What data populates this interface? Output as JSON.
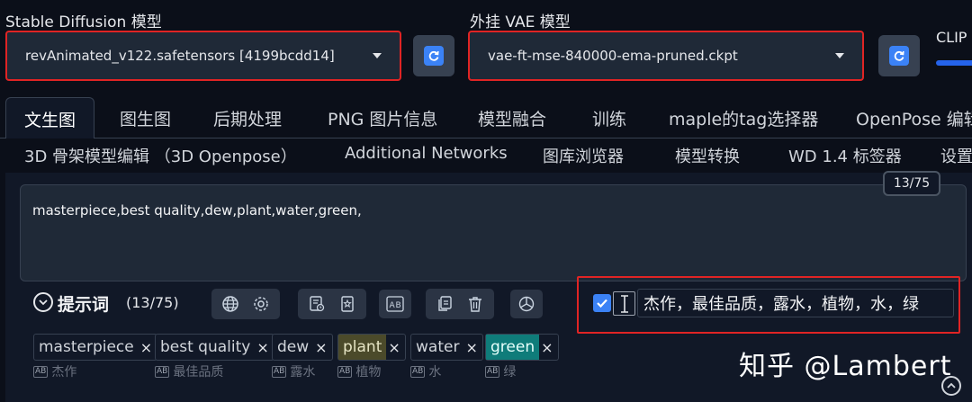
{
  "models": {
    "sd_label": "Stable Diffusion 模型",
    "sd_value": "revAnimated_v122.safetensors [4199bcdd14]",
    "vae_label": "外挂 VAE 模型",
    "vae_value": "vae-ft-mse-840000-ema-pruned.ckpt",
    "clip_label": "CLIP 终"
  },
  "tabs_row1": [
    "文生图",
    "图生图",
    "后期处理",
    "PNG 图片信息",
    "模型融合",
    "训练",
    "maple的tag选择器",
    "OpenPose 编辑"
  ],
  "tabs_row2": [
    "3D 骨架模型编辑 （3D Openpose）",
    "Additional Networks",
    "图库浏览器",
    "模型转换",
    "WD 1.4 标签器",
    "设置"
  ],
  "prompt": {
    "text": "masterpiece,best quality,dew,plant,water,green,",
    "counter": "13/75"
  },
  "panel": {
    "title": "提示词",
    "count": "(13/75)",
    "translation_input": "杰作，最佳品质，露水，植物，水，绿"
  },
  "tags": [
    {
      "text": "masterpiece",
      "trans": "杰作"
    },
    {
      "text": "best quality",
      "trans": "最佳品质"
    },
    {
      "text": "dew",
      "trans": "露水"
    },
    {
      "text": "plant",
      "trans": "植物"
    },
    {
      "text": "water",
      "trans": "水"
    },
    {
      "text": "green",
      "trans": "绿"
    }
  ],
  "ab_glyph": "AB",
  "close_glyph": "×",
  "watermark": "知乎 @Lambert",
  "colors": {
    "background": "#0b0f19",
    "accent_blue": "#3b82f6",
    "highlight_red": "#e02424",
    "plant_tag": "#4b4a2a",
    "green_tag": "#0f7c7a"
  }
}
